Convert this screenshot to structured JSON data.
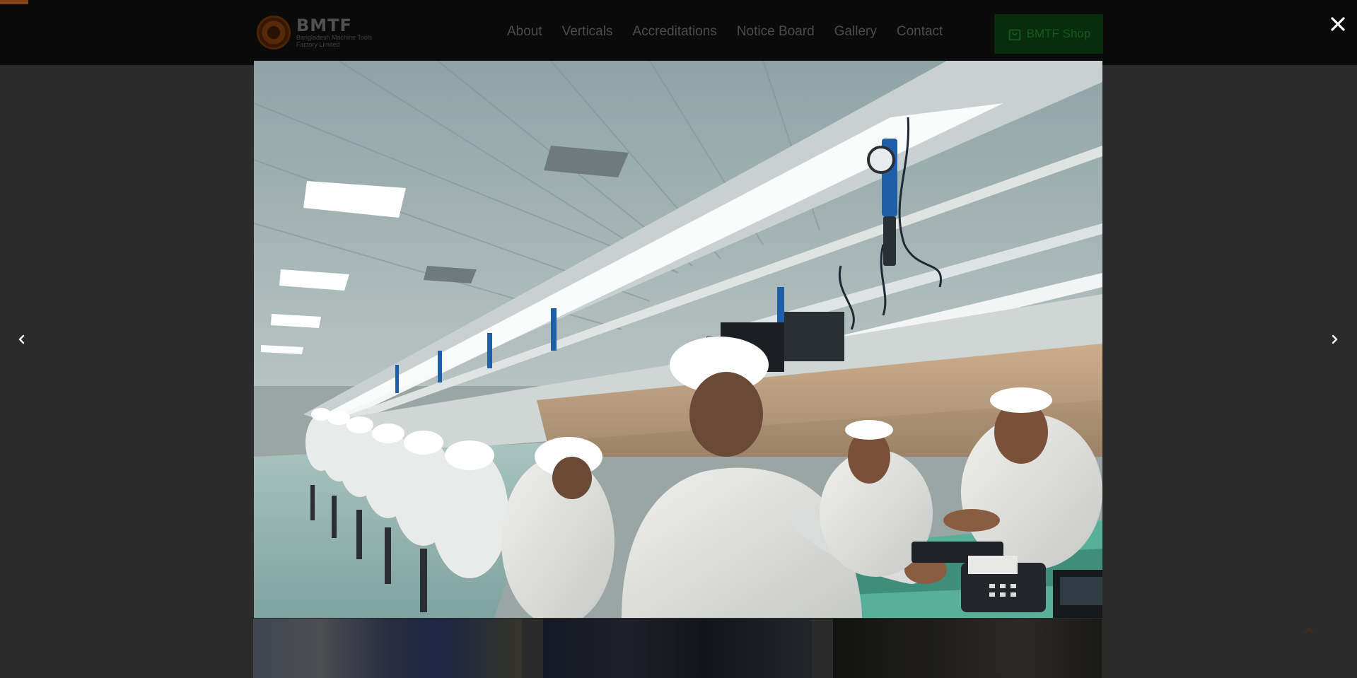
{
  "header": {
    "logo": {
      "title": "BMTF",
      "subtitle_line1": "Bangladesh Machine Tools",
      "subtitle_line2": "Factory Limited"
    },
    "nav": [
      {
        "label": "About"
      },
      {
        "label": "Verticals"
      },
      {
        "label": "Accreditations"
      },
      {
        "label": "Notice Board"
      },
      {
        "label": "Gallery"
      },
      {
        "label": "Contact"
      }
    ],
    "shop_button": {
      "label": "BMTF Shop",
      "icon": "shopping-bag-icon"
    }
  },
  "lightbox": {
    "image_subject": "factory-assembly-line-photo",
    "close_icon": "close-icon",
    "prev_icon": "chevron-left-icon",
    "next_icon": "chevron-right-icon"
  },
  "gallery": {
    "thumbnails": [
      "thumbnail-1",
      "thumbnail-2",
      "thumbnail-3"
    ],
    "back_to_top_icon": "chevron-up-icon"
  },
  "colors": {
    "header_bg": "#0f0f0f",
    "accent": "#b35a20",
    "shop_bg": "#0a3f12",
    "overlay": "rgba(0,0,0,0.28)"
  }
}
